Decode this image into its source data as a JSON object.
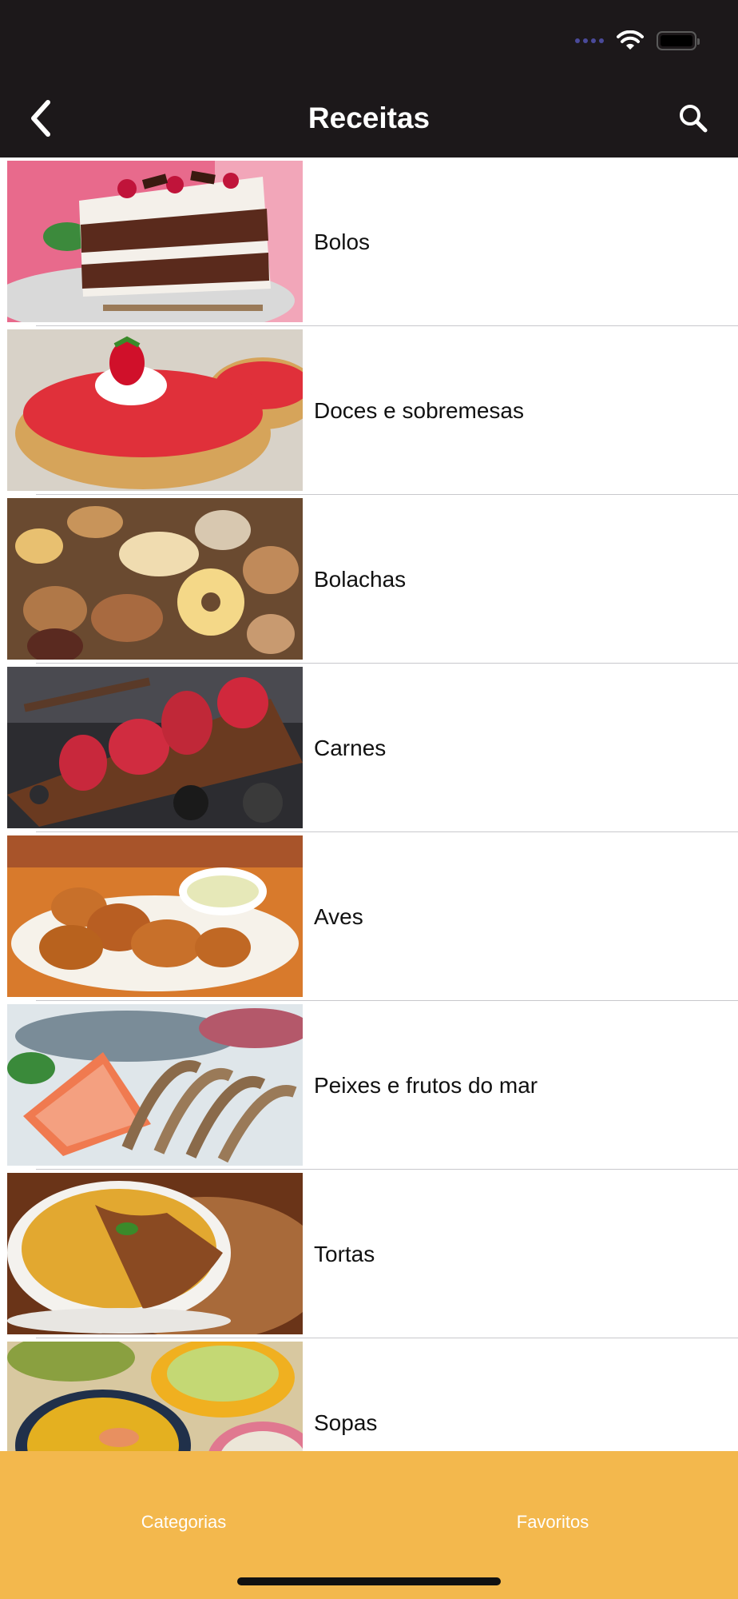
{
  "nav": {
    "title": "Receitas"
  },
  "categories": [
    {
      "label": "Bolos",
      "image": "cake-photo"
    },
    {
      "label": "Doces e sobremesas",
      "image": "strawberry-tart-photo"
    },
    {
      "label": "Bolachas",
      "image": "cookies-photo"
    },
    {
      "label": "Carnes",
      "image": "steaks-photo"
    },
    {
      "label": "Aves",
      "image": "chicken-photo"
    },
    {
      "label": "Peixes e frutos do mar",
      "image": "seafood-photo"
    },
    {
      "label": "Tortas",
      "image": "pie-photo"
    },
    {
      "label": "Sopas",
      "image": "soups-photo"
    }
  ],
  "tabs": {
    "categorias": "Categorias",
    "favoritos": "Favoritos"
  },
  "colors": {
    "nav_background": "#1c181a",
    "tabbar_background": "#f3b84d"
  }
}
